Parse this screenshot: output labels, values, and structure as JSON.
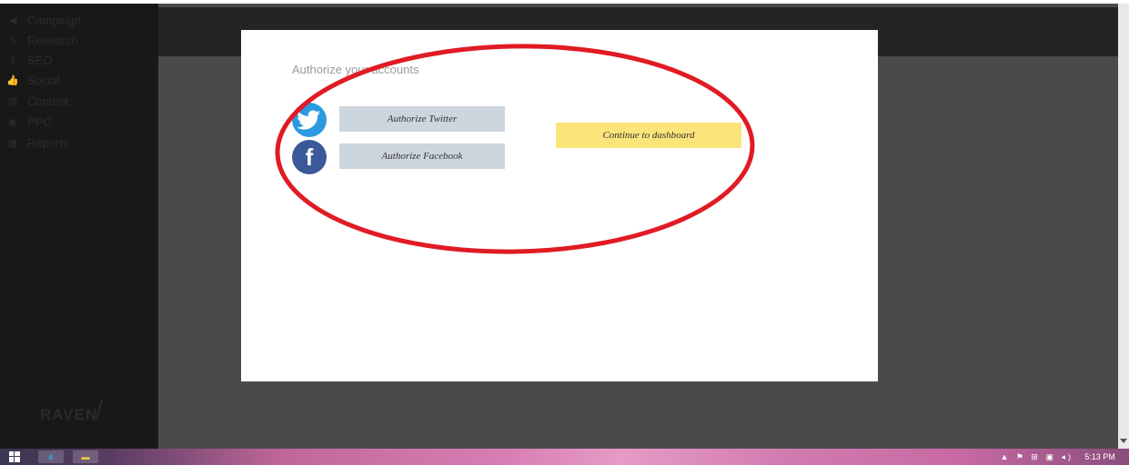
{
  "sidebar": {
    "items": [
      {
        "icon": "megaphone-icon",
        "glyph": "◀",
        "label": "Campaign"
      },
      {
        "icon": "research-icon",
        "glyph": "✎",
        "label": "Research"
      },
      {
        "icon": "key-icon",
        "glyph": "⚷",
        "label": "SEO"
      },
      {
        "icon": "thumbs-up-icon",
        "glyph": "👍",
        "label": "Social"
      },
      {
        "icon": "content-icon",
        "glyph": "▤",
        "label": "Content"
      },
      {
        "icon": "ppc-icon",
        "glyph": "◉",
        "label": "PPC"
      },
      {
        "icon": "reports-icon",
        "glyph": "▦",
        "label": "Reports"
      }
    ],
    "logo_text": "RAVEN"
  },
  "modal": {
    "title": "Authorize your accounts",
    "twitter_button": "Authorize Twitter",
    "facebook_button": "Authorize Facebook",
    "continue_button": "Continue to dashboard",
    "twitter_icon": "twitter-icon",
    "facebook_icon": "facebook-icon"
  },
  "taskbar": {
    "tray_icons": "▲ ⚑ ⊞ ▣ ◂)",
    "clock": "5:13 PM"
  },
  "colors": {
    "annotation": "#e01b24",
    "continue_bg": "#fbe47a",
    "auth_btn_bg": "#cdd5de",
    "twitter": "#2b9ae0",
    "facebook": "#3b5998"
  }
}
